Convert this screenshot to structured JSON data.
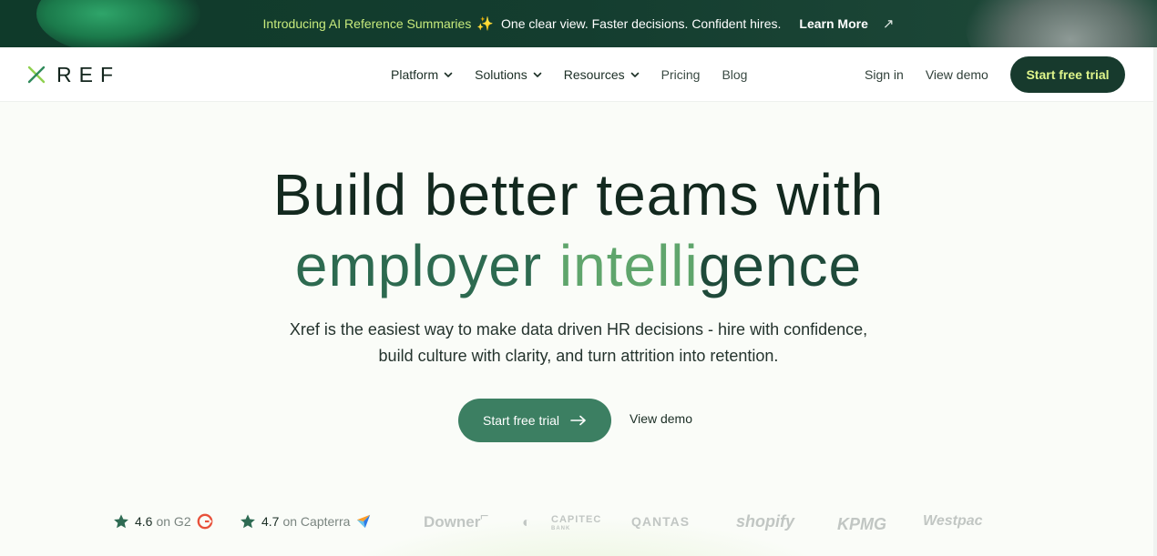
{
  "announcement": {
    "intro": "Introducing AI Reference Summaries",
    "sparkle_icon": "sparkle-icon",
    "text": "One clear view. Faster decisions. Confident hires.",
    "learn_more": "Learn More",
    "arrow_icon": "arrow-up-right-icon"
  },
  "nav": {
    "logo_text": "REF",
    "items": [
      {
        "label": "Platform",
        "dropdown": true
      },
      {
        "label": "Solutions",
        "dropdown": true
      },
      {
        "label": "Resources",
        "dropdown": true
      },
      {
        "label": "Pricing",
        "dropdown": false
      },
      {
        "label": "Blog",
        "dropdown": false
      }
    ],
    "sign_in": "Sign in",
    "view_demo": "View demo",
    "cta": "Start free trial"
  },
  "hero": {
    "headline_line1": "Build better teams with",
    "headline_line2_a": "employer ",
    "headline_line2_b": "intelli",
    "headline_line2_c": "gence",
    "subtitle": "Xref is the easiest way to make data driven HR decisions - hire with confidence, build culture with clarity, and turn attrition into retention.",
    "primary_button": "Start free trial",
    "secondary_button": "View demo"
  },
  "ratings": [
    {
      "score": "4.6",
      "on": "on G2"
    },
    {
      "score": "4.7",
      "on": "on Capterra"
    }
  ],
  "logos": [
    "Downer",
    "CAPITEC",
    "BANK",
    "QANTAS",
    "shopify",
    "KPMG",
    "Westpac"
  ],
  "colors": {
    "brand_dark": "#173a2d",
    "accent_lime": "#dff58b",
    "primary_green": "#3c7f62",
    "headline_green": "#2d6a50"
  }
}
